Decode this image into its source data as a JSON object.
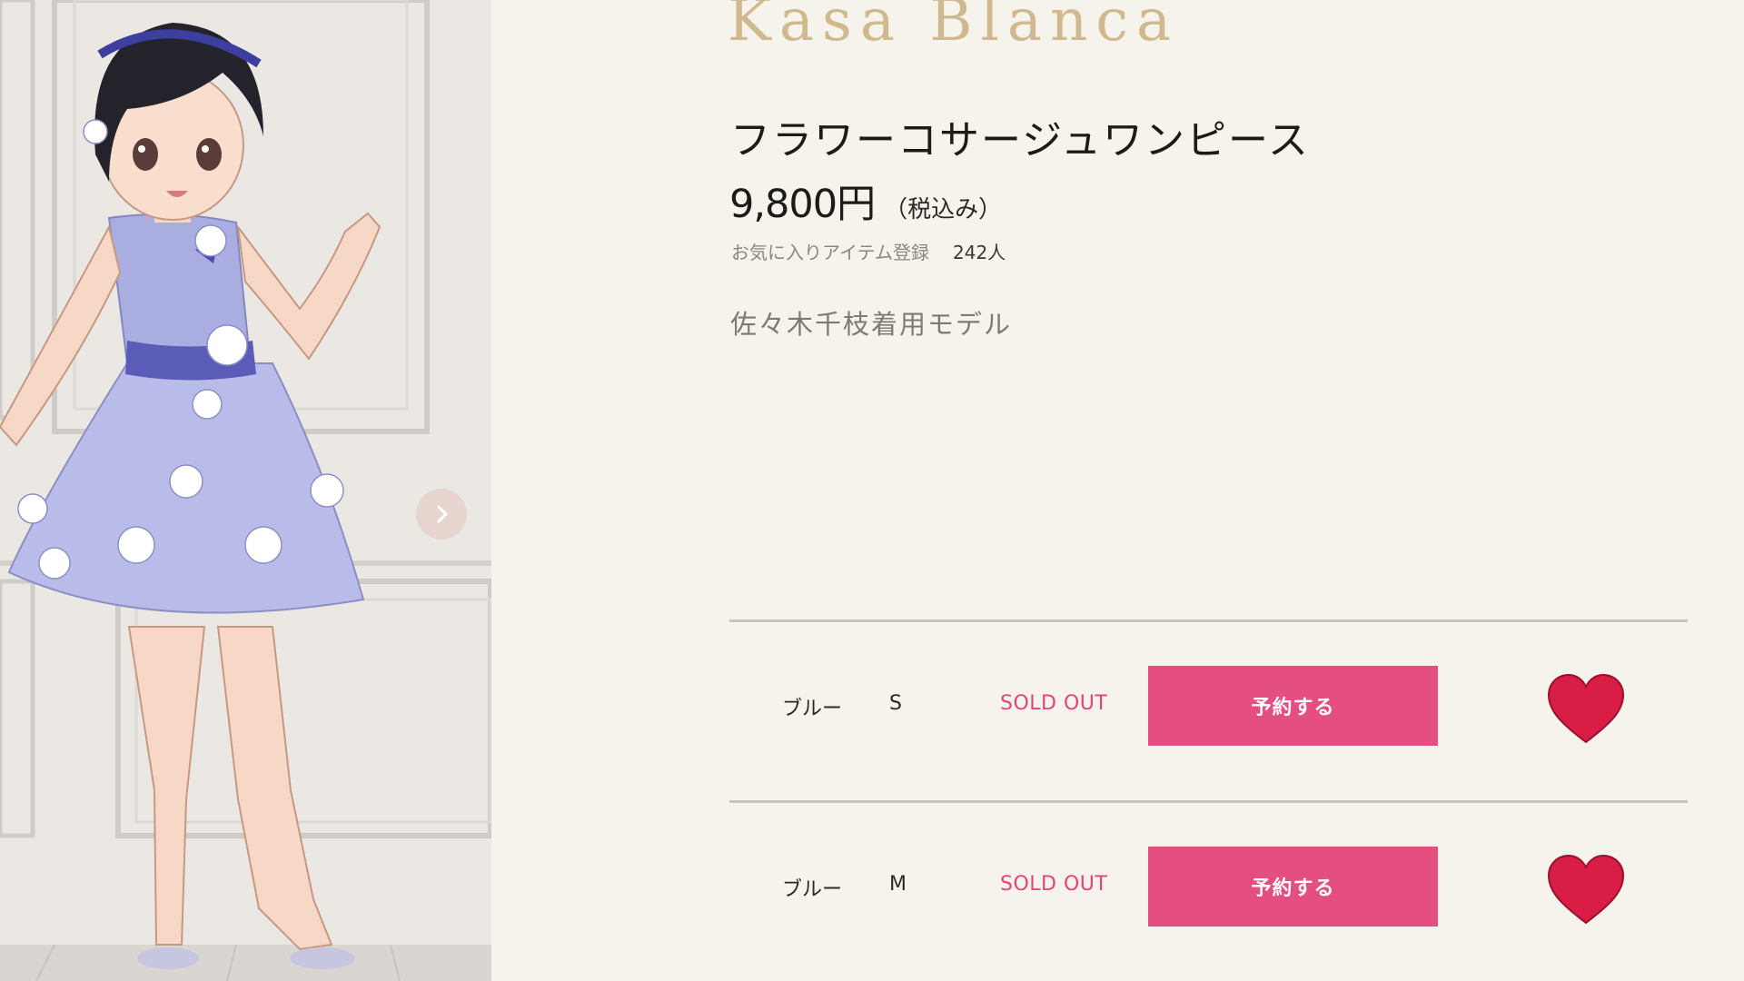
{
  "brand": {
    "name": "Kasa Blanca",
    "color": "#d0b88f"
  },
  "product": {
    "title": "フラワーコサージュワンピース",
    "price": "9,800円",
    "tax_note": "（税込み）",
    "favorite_label": "お気に入りアイテム登録",
    "favorite_count": "242人",
    "model_note": "佐々木千枝着用モデル"
  },
  "variants": [
    {
      "color": "ブルー",
      "size": "S",
      "stock": "SOLD OUT",
      "button": "予約する"
    },
    {
      "color": "ブルー",
      "size": "M",
      "stock": "SOLD OUT",
      "button": "予約する"
    }
  ],
  "colors": {
    "accent": "#e54e80",
    "sold_out": "#e3447a",
    "heart": "#d81e45"
  },
  "icons": {
    "next_slide": "chevron-right-icon",
    "favorite": "heart-icon"
  }
}
